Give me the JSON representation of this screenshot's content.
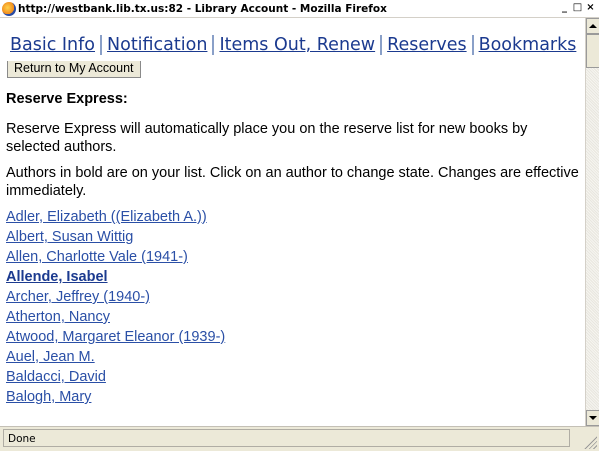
{
  "window": {
    "title": "http://westbank.lib.tx.us:82 - Library Account - Mozilla Firefox",
    "controls": [
      "_",
      "□",
      "×"
    ]
  },
  "tabs": [
    {
      "label": "Basic Info"
    },
    {
      "label": "Notification"
    },
    {
      "label": "Items Out, Renew"
    },
    {
      "label": "Reserves"
    },
    {
      "label": "Bookmarks"
    }
  ],
  "content": {
    "return_button": "Return to My Account",
    "heading": "Reserve Express:",
    "description": "Reserve Express will automatically place you on the reserve list for new books by selected authors.",
    "instructions": "Authors in bold are on your list. Click on an author to change state. Changes are effective immediately.",
    "authors": [
      {
        "name": "Adler, Elizabeth ((Elizabeth A.))",
        "selected": false
      },
      {
        "name": "Albert, Susan Wittig",
        "selected": false
      },
      {
        "name": "Allen, Charlotte Vale (1941-)",
        "selected": false
      },
      {
        "name": "Allende, Isabel",
        "selected": true
      },
      {
        "name": "Archer, Jeffrey (1940-)",
        "selected": false
      },
      {
        "name": "Atherton, Nancy",
        "selected": false
      },
      {
        "name": "Atwood, Margaret Eleanor (1939-)",
        "selected": false
      },
      {
        "name": "Auel, Jean M.",
        "selected": false
      },
      {
        "name": "Baldacci, David",
        "selected": false
      },
      {
        "name": "Balogh, Mary",
        "selected": false
      }
    ]
  },
  "status": {
    "text": "Done"
  },
  "colors": {
    "link": "#2a4fa6",
    "tab_link": "#1b3a8f",
    "chrome": "#ece9d8"
  }
}
